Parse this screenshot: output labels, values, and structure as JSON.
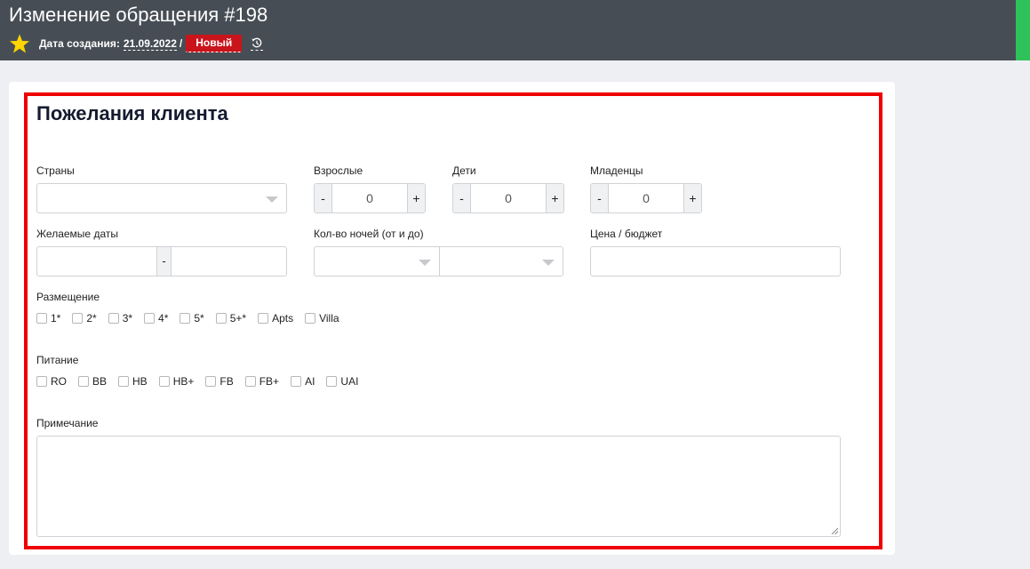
{
  "header": {
    "title": "Изменение обращения #198",
    "created_label": "Дата создания:",
    "created_date": "21.09.2022",
    "separator": "/",
    "status": "Новый",
    "accent_color": "#2fc15a",
    "status_color": "#c9141b",
    "icons": [
      "star-icon",
      "history-icon"
    ]
  },
  "section": {
    "title": "Пожелания клиента"
  },
  "fields": {
    "countries_label": "Страны",
    "adults_label": "Взрослые",
    "adults_value": "0",
    "children_label": "Дети",
    "children_value": "0",
    "infants_label": "Младенцы",
    "infants_value": "0",
    "minus": "-",
    "plus": "+",
    "dates_label": "Желаемые даты",
    "dates_sep": "-",
    "nights_label": "Кол-во ночей (от и до)",
    "budget_label": "Цена / бюджет",
    "accommodation_label": "Размещение",
    "accommodation_options": [
      "1*",
      "2*",
      "3*",
      "4*",
      "5*",
      "5+*",
      "Apts",
      "Villa"
    ],
    "meal_label": "Питание",
    "meal_options": [
      "RO",
      "BB",
      "HB",
      "HB+",
      "FB",
      "FB+",
      "AI",
      "UAI"
    ],
    "note_label": "Примечание"
  }
}
